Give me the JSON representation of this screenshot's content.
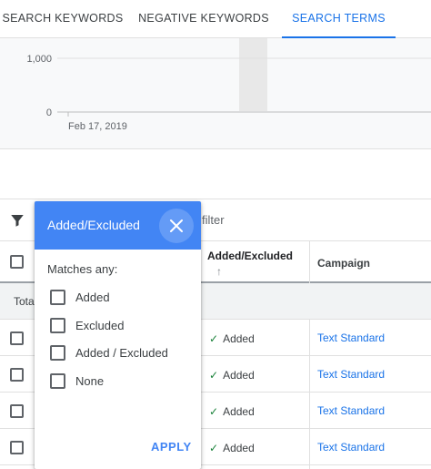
{
  "tabs": [
    {
      "label": "SEARCH KEYWORDS"
    },
    {
      "label": "NEGATIVE KEYWORDS"
    },
    {
      "label": "SEARCH TERMS"
    }
  ],
  "chart_data": {
    "type": "line",
    "yticks": [
      "1,000",
      "0"
    ],
    "xticks": [
      "Feb 17, 2019"
    ]
  },
  "table": {
    "filter_text": "filter",
    "headers": {
      "added_excluded": "Added/Excluded",
      "campaign": "Campaign"
    },
    "total_label": "Tota",
    "rows": [
      {
        "status": "Added",
        "campaign": "Text Standard"
      },
      {
        "status": "Added",
        "campaign": "Text Standard"
      },
      {
        "status": "Added",
        "campaign": "Text Standard"
      },
      {
        "status": "Added",
        "campaign": "Text Standard"
      }
    ]
  },
  "popup": {
    "title": "Added/Excluded",
    "matches_label": "Matches any:",
    "options": [
      {
        "label": "Added"
      },
      {
        "label": "Excluded"
      },
      {
        "label": "Added / Excluded"
      },
      {
        "label": "None"
      }
    ],
    "apply_label": "APPLY"
  },
  "colors": {
    "accent": "#1a73e8",
    "popup_header": "#4285f4",
    "success": "#188038"
  }
}
